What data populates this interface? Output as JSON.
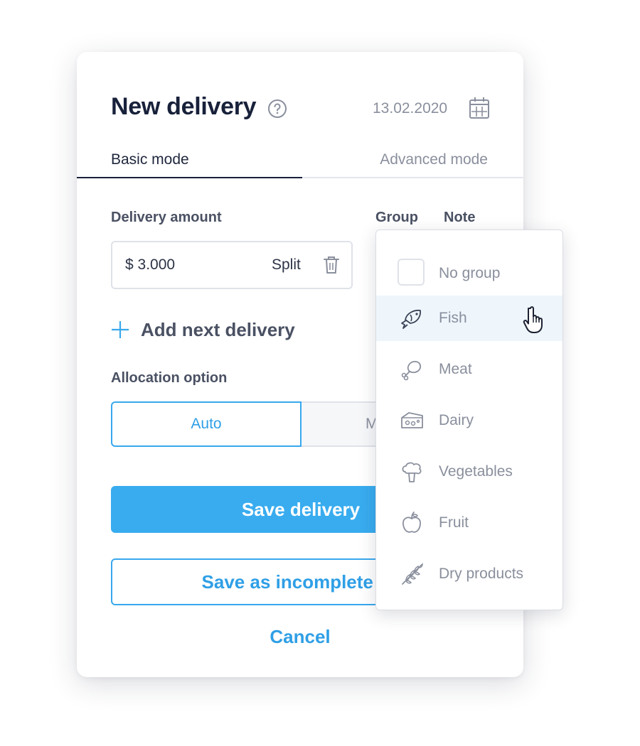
{
  "dialog": {
    "title": "New delivery",
    "date": "13.02.2020"
  },
  "tabs": [
    {
      "label": "Basic mode",
      "active": true
    },
    {
      "label": "Advanced mode",
      "active": false
    }
  ],
  "columns": {
    "amount_label": "Delivery amount",
    "group_label": "Group",
    "note_label": "Note"
  },
  "delivery": {
    "amount": "$ 3.000",
    "split_label": "Split"
  },
  "add_next_label": "Add next delivery",
  "allocation": {
    "label": "Allocation option",
    "options": [
      {
        "label": "Auto",
        "selected": true
      },
      {
        "label": "M",
        "selected": false
      }
    ]
  },
  "buttons": {
    "save": "Save delivery",
    "save_incomplete": "Save as incomplete de",
    "cancel": "Cancel"
  },
  "group_dropdown": {
    "items": [
      {
        "label": "No group",
        "icon": "checkbox"
      },
      {
        "label": "Fish",
        "icon": "fish-icon",
        "hovered": true
      },
      {
        "label": "Meat",
        "icon": "meat-icon"
      },
      {
        "label": "Dairy",
        "icon": "cheese-icon"
      },
      {
        "label": "Vegetables",
        "icon": "broccoli-icon"
      },
      {
        "label": "Fruit",
        "icon": "apple-icon"
      },
      {
        "label": "Dry products",
        "icon": "wheat-icon"
      }
    ]
  },
  "colors": {
    "accent": "#38acef",
    "title": "#18213a",
    "muted": "#8a8f9d",
    "hover_row": "#eef6fc"
  }
}
